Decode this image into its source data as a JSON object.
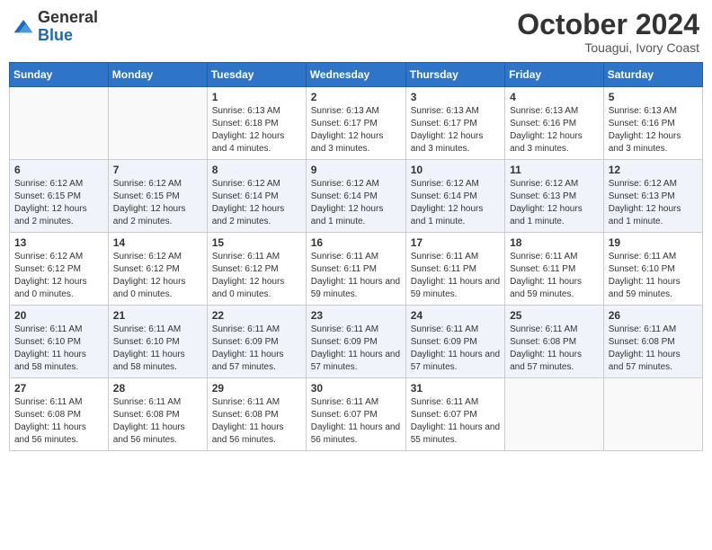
{
  "header": {
    "logo_general": "General",
    "logo_blue": "Blue",
    "month": "October 2024",
    "location": "Touagui, Ivory Coast"
  },
  "weekdays": [
    "Sunday",
    "Monday",
    "Tuesday",
    "Wednesday",
    "Thursday",
    "Friday",
    "Saturday"
  ],
  "weeks": [
    [
      {
        "day": "",
        "info": ""
      },
      {
        "day": "",
        "info": ""
      },
      {
        "day": "1",
        "info": "Sunrise: 6:13 AM\nSunset: 6:18 PM\nDaylight: 12 hours and 4 minutes."
      },
      {
        "day": "2",
        "info": "Sunrise: 6:13 AM\nSunset: 6:17 PM\nDaylight: 12 hours and 3 minutes."
      },
      {
        "day": "3",
        "info": "Sunrise: 6:13 AM\nSunset: 6:17 PM\nDaylight: 12 hours and 3 minutes."
      },
      {
        "day": "4",
        "info": "Sunrise: 6:13 AM\nSunset: 6:16 PM\nDaylight: 12 hours and 3 minutes."
      },
      {
        "day": "5",
        "info": "Sunrise: 6:13 AM\nSunset: 6:16 PM\nDaylight: 12 hours and 3 minutes."
      }
    ],
    [
      {
        "day": "6",
        "info": "Sunrise: 6:12 AM\nSunset: 6:15 PM\nDaylight: 12 hours and 2 minutes."
      },
      {
        "day": "7",
        "info": "Sunrise: 6:12 AM\nSunset: 6:15 PM\nDaylight: 12 hours and 2 minutes."
      },
      {
        "day": "8",
        "info": "Sunrise: 6:12 AM\nSunset: 6:14 PM\nDaylight: 12 hours and 2 minutes."
      },
      {
        "day": "9",
        "info": "Sunrise: 6:12 AM\nSunset: 6:14 PM\nDaylight: 12 hours and 1 minute."
      },
      {
        "day": "10",
        "info": "Sunrise: 6:12 AM\nSunset: 6:14 PM\nDaylight: 12 hours and 1 minute."
      },
      {
        "day": "11",
        "info": "Sunrise: 6:12 AM\nSunset: 6:13 PM\nDaylight: 12 hours and 1 minute."
      },
      {
        "day": "12",
        "info": "Sunrise: 6:12 AM\nSunset: 6:13 PM\nDaylight: 12 hours and 1 minute."
      }
    ],
    [
      {
        "day": "13",
        "info": "Sunrise: 6:12 AM\nSunset: 6:12 PM\nDaylight: 12 hours and 0 minutes."
      },
      {
        "day": "14",
        "info": "Sunrise: 6:12 AM\nSunset: 6:12 PM\nDaylight: 12 hours and 0 minutes."
      },
      {
        "day": "15",
        "info": "Sunrise: 6:11 AM\nSunset: 6:12 PM\nDaylight: 12 hours and 0 minutes."
      },
      {
        "day": "16",
        "info": "Sunrise: 6:11 AM\nSunset: 6:11 PM\nDaylight: 11 hours and 59 minutes."
      },
      {
        "day": "17",
        "info": "Sunrise: 6:11 AM\nSunset: 6:11 PM\nDaylight: 11 hours and 59 minutes."
      },
      {
        "day": "18",
        "info": "Sunrise: 6:11 AM\nSunset: 6:11 PM\nDaylight: 11 hours and 59 minutes."
      },
      {
        "day": "19",
        "info": "Sunrise: 6:11 AM\nSunset: 6:10 PM\nDaylight: 11 hours and 59 minutes."
      }
    ],
    [
      {
        "day": "20",
        "info": "Sunrise: 6:11 AM\nSunset: 6:10 PM\nDaylight: 11 hours and 58 minutes."
      },
      {
        "day": "21",
        "info": "Sunrise: 6:11 AM\nSunset: 6:10 PM\nDaylight: 11 hours and 58 minutes."
      },
      {
        "day": "22",
        "info": "Sunrise: 6:11 AM\nSunset: 6:09 PM\nDaylight: 11 hours and 57 minutes."
      },
      {
        "day": "23",
        "info": "Sunrise: 6:11 AM\nSunset: 6:09 PM\nDaylight: 11 hours and 57 minutes."
      },
      {
        "day": "24",
        "info": "Sunrise: 6:11 AM\nSunset: 6:09 PM\nDaylight: 11 hours and 57 minutes."
      },
      {
        "day": "25",
        "info": "Sunrise: 6:11 AM\nSunset: 6:08 PM\nDaylight: 11 hours and 57 minutes."
      },
      {
        "day": "26",
        "info": "Sunrise: 6:11 AM\nSunset: 6:08 PM\nDaylight: 11 hours and 57 minutes."
      }
    ],
    [
      {
        "day": "27",
        "info": "Sunrise: 6:11 AM\nSunset: 6:08 PM\nDaylight: 11 hours and 56 minutes."
      },
      {
        "day": "28",
        "info": "Sunrise: 6:11 AM\nSunset: 6:08 PM\nDaylight: 11 hours and 56 minutes."
      },
      {
        "day": "29",
        "info": "Sunrise: 6:11 AM\nSunset: 6:08 PM\nDaylight: 11 hours and 56 minutes."
      },
      {
        "day": "30",
        "info": "Sunrise: 6:11 AM\nSunset: 6:07 PM\nDaylight: 11 hours and 56 minutes."
      },
      {
        "day": "31",
        "info": "Sunrise: 6:11 AM\nSunset: 6:07 PM\nDaylight: 11 hours and 55 minutes."
      },
      {
        "day": "",
        "info": ""
      },
      {
        "day": "",
        "info": ""
      }
    ]
  ]
}
